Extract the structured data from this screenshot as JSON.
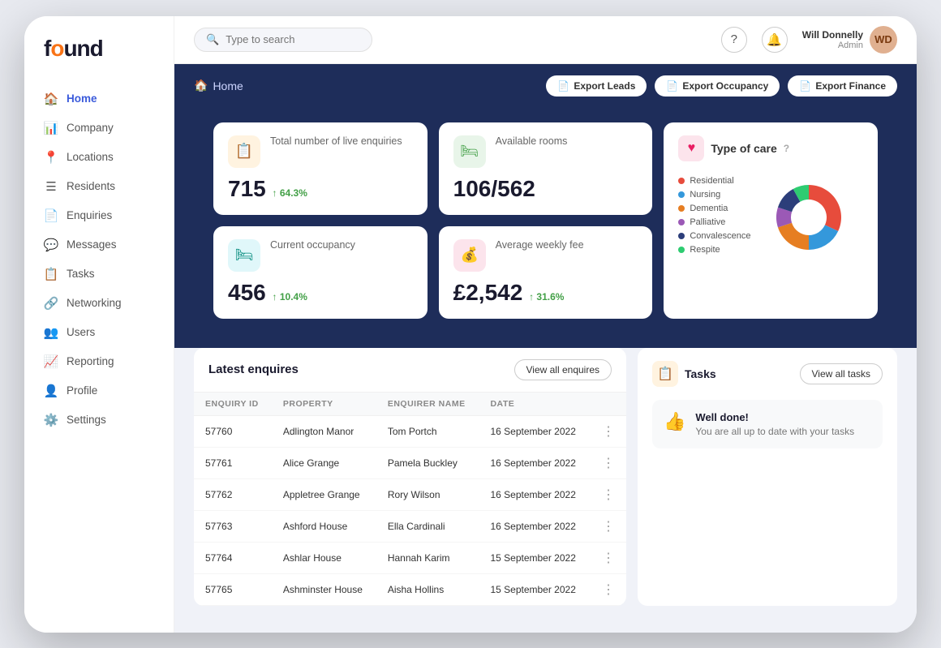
{
  "app": {
    "logo": "found",
    "logo_o": "o"
  },
  "search": {
    "placeholder": "Type to search"
  },
  "user": {
    "name": "Will Donnelly",
    "role": "Admin",
    "initials": "WD"
  },
  "nav": {
    "items": [
      {
        "id": "home",
        "label": "Home",
        "icon": "🏠",
        "active": true
      },
      {
        "id": "company",
        "label": "Company",
        "icon": "📊"
      },
      {
        "id": "locations",
        "label": "Locations",
        "icon": "📍"
      },
      {
        "id": "residents",
        "label": "Residents",
        "icon": "☰"
      },
      {
        "id": "enquiries",
        "label": "Enquiries",
        "icon": "📄"
      },
      {
        "id": "messages",
        "label": "Messages",
        "icon": "💬"
      },
      {
        "id": "tasks",
        "label": "Tasks",
        "icon": "📋"
      },
      {
        "id": "networking",
        "label": "Networking",
        "icon": "🔗"
      },
      {
        "id": "users",
        "label": "Users",
        "icon": "👥"
      },
      {
        "id": "reporting",
        "label": "Reporting",
        "icon": "📈"
      },
      {
        "id": "profile",
        "label": "Profile",
        "icon": "👤"
      },
      {
        "id": "settings",
        "label": "Settings",
        "icon": "⚙️"
      }
    ]
  },
  "breadcrumb": {
    "icon": "🏠",
    "label": "Home"
  },
  "export_buttons": [
    {
      "id": "export-leads",
      "label": "Export Leads",
      "icon": "📄"
    },
    {
      "id": "export-occupancy",
      "label": "Export Occupancy",
      "icon": "📄"
    },
    {
      "id": "export-finance",
      "label": "Export Finance",
      "icon": "📄"
    }
  ],
  "stats": [
    {
      "id": "live-enquiries",
      "title": "Total number of live enquiries",
      "value": "715",
      "change": "64.3%",
      "icon": "📋",
      "icon_style": "orange",
      "span": 1
    },
    {
      "id": "available-rooms",
      "title": "Available rooms",
      "value": "106/562",
      "change": null,
      "icon": "🛏",
      "icon_style": "green",
      "span": 1
    },
    {
      "id": "current-occupancy",
      "title": "Current occupancy",
      "value": "456",
      "change": "10.4%",
      "icon": "🛏",
      "icon_style": "teal",
      "span": 1
    },
    {
      "id": "average-weekly-fee",
      "title": "Average weekly fee",
      "value": "£2,542",
      "change": "31.6%",
      "icon": "💰",
      "icon_style": "red",
      "span": 1
    }
  ],
  "type_of_care": {
    "title": "Type of care",
    "legend": [
      {
        "label": "Residential",
        "color": "#e74c3c"
      },
      {
        "label": "Nursing",
        "color": "#3498db"
      },
      {
        "label": "Dementia",
        "color": "#e67e22"
      },
      {
        "label": "Palliative",
        "color": "#9b59b6"
      },
      {
        "label": "Convalescence",
        "color": "#2c3e7a"
      },
      {
        "label": "Respite",
        "color": "#2ecc71"
      }
    ],
    "donut_segments": [
      {
        "label": "Residential",
        "color": "#e74c3c",
        "percent": 32
      },
      {
        "label": "Nursing",
        "color": "#3498db",
        "percent": 18
      },
      {
        "label": "Dementia",
        "color": "#e67e22",
        "percent": 20
      },
      {
        "label": "Palliative",
        "color": "#9b59b6",
        "percent": 10
      },
      {
        "label": "Convalescence",
        "color": "#2c3e7a",
        "percent": 12
      },
      {
        "label": "Respite",
        "color": "#2ecc71",
        "percent": 8
      }
    ]
  },
  "enquiries": {
    "title": "Latest enquires",
    "view_all_label": "View all enquires",
    "columns": [
      "Enquiry ID",
      "Property",
      "Enquirer Name",
      "Date"
    ],
    "rows": [
      {
        "id": "57760",
        "property": "Adlington Manor",
        "name": "Tom Portch",
        "date": "16 September 2022"
      },
      {
        "id": "57761",
        "property": "Alice Grange",
        "name": "Pamela Buckley",
        "date": "16 September 2022"
      },
      {
        "id": "57762",
        "property": "Appletree Grange",
        "name": "Rory Wilson",
        "date": "16 September 2022"
      },
      {
        "id": "57763",
        "property": "Ashford House",
        "name": "Ella Cardinali",
        "date": "16 September 2022"
      },
      {
        "id": "57764",
        "property": "Ashlar House",
        "name": "Hannah Karim",
        "date": "15 September 2022"
      },
      {
        "id": "57765",
        "property": "Ashminster House",
        "name": "Aisha Hollins",
        "date": "15 September 2022"
      }
    ]
  },
  "tasks": {
    "title": "Tasks",
    "view_all_label": "View all tasks",
    "well_done_title": "Well done!",
    "well_done_subtitle": "You are all up to date with your tasks"
  }
}
